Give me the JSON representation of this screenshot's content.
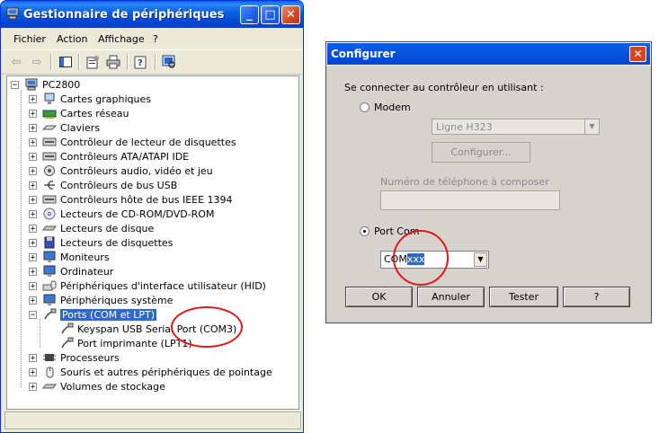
{
  "device_manager": {
    "title": "Gestionnaire de périphériques",
    "menu": [
      "Fichier",
      "Action",
      "Affichage",
      "?"
    ],
    "root": "PC2800",
    "items": [
      "Cartes graphiques",
      "Cartes réseau",
      "Claviers",
      "Contrôleur de lecteur de disquettes",
      "Contrôleurs ATA/ATAPI IDE",
      "Contrôleurs audio, vidéo et jeu",
      "Contrôleurs de bus USB",
      "Contrôleurs hôte de bus IEEE 1394",
      "Lecteurs de CD-ROM/DVD-ROM",
      "Lecteurs de disque",
      "Lecteurs de disquettes",
      "Moniteurs",
      "Ordinateur",
      "Périphériques d'interface utilisateur (HID)",
      "Périphériques système",
      "Ports (COM et LPT)",
      "Keyspan USB Serial Port (COM3)",
      "Port imprimante (LPT1)",
      "Processeurs",
      "Souris et autres périphériques de pointage",
      "Volumes de stockage"
    ]
  },
  "configurer": {
    "title": "Configurer",
    "prompt": "Se connecter au contrôleur en utilisant :",
    "modem_label": "Modem",
    "modem_line": "Ligne H323",
    "configure_button": "Configurer...",
    "phone_label": "Numéro de téléphone à composer",
    "port_com_label": "Port Com",
    "port_value_prefix": "COM",
    "port_value_selected": "xxx",
    "buttons": {
      "ok": "OK",
      "cancel": "Annuler",
      "test": "Tester",
      "help": "?"
    }
  }
}
